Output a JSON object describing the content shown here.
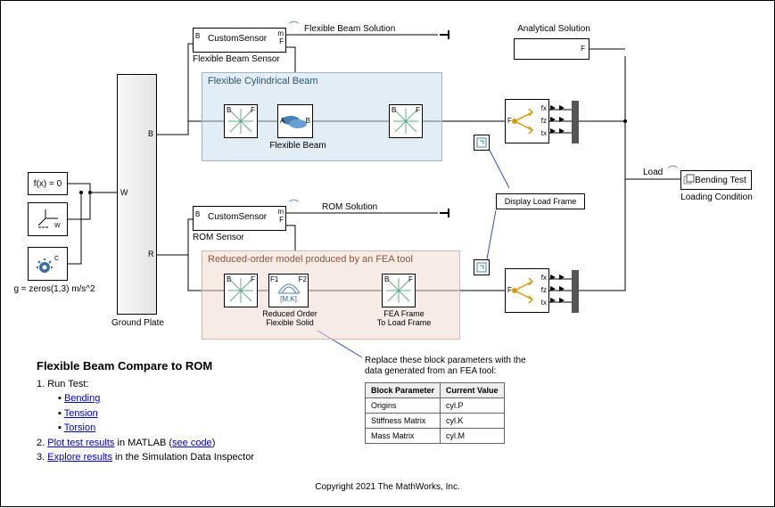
{
  "source_blocks": {
    "fcn": "f(x) = 0",
    "gravity": "g = zeros(1,3) m/s^2"
  },
  "ground_plate": {
    "label": "Ground Plate",
    "port_w": "W",
    "port_b": "B",
    "port_r": "R"
  },
  "top_sensor": {
    "title": "CustomSensor",
    "label": "Flexible Beam Sensor",
    "port_b": "B",
    "port_m": "m",
    "port_f": "F",
    "signal": "Flexible Beam Solution"
  },
  "bottom_sensor": {
    "title": "CustomSensor",
    "label": "ROM Sensor",
    "port_b": "B",
    "port_m": "m",
    "port_f": "F",
    "signal": "ROM Solution"
  },
  "region_top": {
    "title": "Flexible Cylindrical Beam",
    "beam_label": "Flexible Beam",
    "joint_left": {
      "b": "B",
      "f": "F"
    },
    "joint_right": {
      "b": "B",
      "f": "F"
    },
    "beam_ports": {
      "a": "A",
      "b": "B"
    }
  },
  "region_bottom": {
    "title": "Reduced-order model produced by an FEA tool",
    "rom_label": "Reduced Order\nFlexible Solid",
    "fea_frame_label": "FEA Frame\nTo Load Frame",
    "rom_ports": {
      "f1": "F1",
      "f2": "F2"
    },
    "rom_mk": "[M,K]",
    "joint_left": {
      "b": "B",
      "f": "F"
    },
    "joint_right": {
      "b": "B",
      "f": "F"
    }
  },
  "analytical": {
    "label": "Analytical Solution",
    "port_f": "F"
  },
  "display_load_frame": "Display Load Frame",
  "force_ports": {
    "f": "F",
    "fx": "fx",
    "fz": "fz",
    "tx": "tx"
  },
  "loading": {
    "signal": "Load",
    "block": "Bending Test",
    "label": "Loading Condition"
  },
  "instructions": {
    "title": "Flexible Beam Compare to ROM",
    "step1": "1. Run Test:",
    "bullets": [
      "Bending",
      "Tension",
      "Torsion"
    ],
    "step2_pre": "2. ",
    "step2_link": "Plot test results",
    "step2_mid": " in MATLAB (",
    "step2_link2": "see code",
    "step2_post": ")",
    "step3_pre": "3. ",
    "step3_link": "Explore results",
    "step3_post": " in the Simulation Data Inspector"
  },
  "table": {
    "caption": "Replace these block parameters with the\ndata generated from an FEA tool:",
    "headers": [
      "Block Parameter",
      "Current Value"
    ],
    "rows": [
      [
        "Origins",
        "cyl.P"
      ],
      [
        "Stiffness Matrix",
        "cyl.K"
      ],
      [
        "Mass Matrix",
        "cyl.M"
      ]
    ]
  },
  "copyright": "Copyright 2021 The MathWorks, Inc."
}
